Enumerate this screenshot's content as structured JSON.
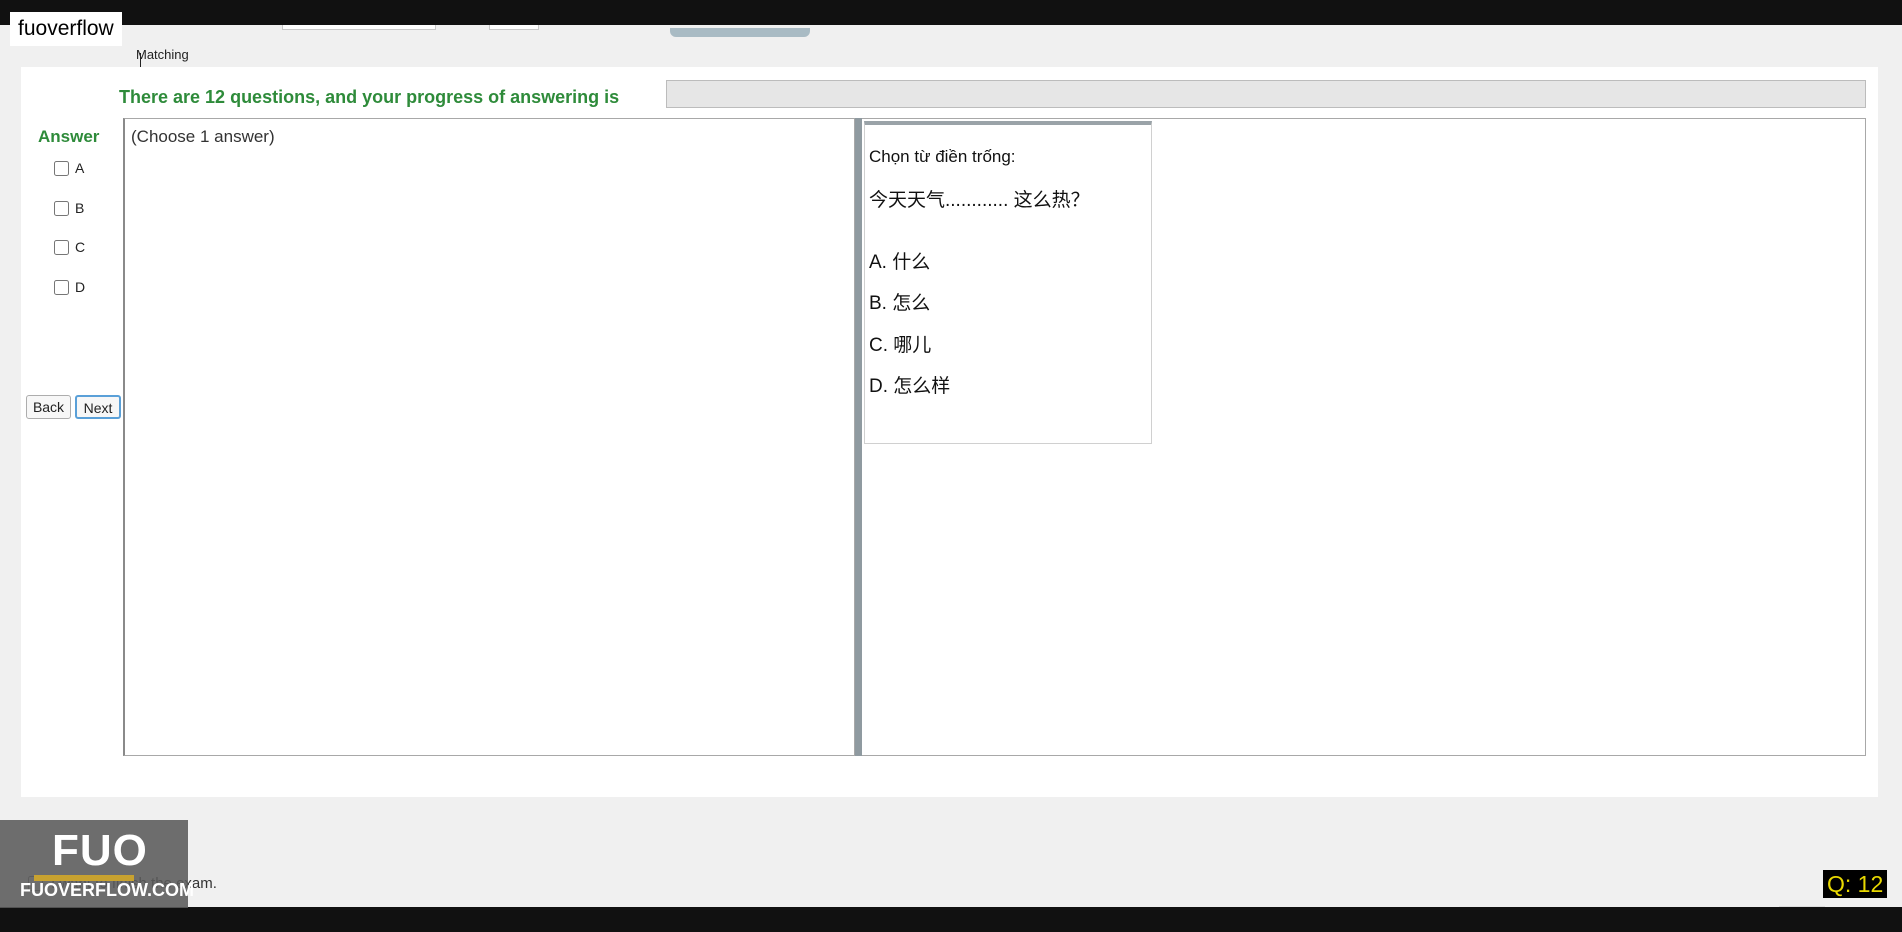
{
  "brand": {
    "tag": "fuoverflow"
  },
  "tab": {
    "label": "Matching"
  },
  "progress": {
    "text": "There are 12 questions, and your progress of answering is",
    "fraction": 0
  },
  "answer": {
    "label": "Answer",
    "options": [
      "A",
      "B",
      "C",
      "D"
    ]
  },
  "nav": {
    "back_label": "Back",
    "next_label": "Next"
  },
  "answer_area": {
    "hint": "(Choose 1 answer)"
  },
  "question": {
    "instruction": "Chọn từ điền trống:",
    "sentence": "今天天气............ 这么热？",
    "choices": [
      "A.  什么",
      "B.  怎么",
      "C.  哪儿",
      "D.  怎么样"
    ]
  },
  "finish": {
    "label": "I want to finish the exam."
  },
  "watermark": {
    "logo_text": "FUO",
    "site": "FUOVERFLOW.COM"
  },
  "counter": {
    "text": "Q: 12"
  },
  "colors": {
    "accent_green": "#2e8b3a",
    "counter_text": "#e8d800",
    "progress_fill": "#06b025"
  }
}
